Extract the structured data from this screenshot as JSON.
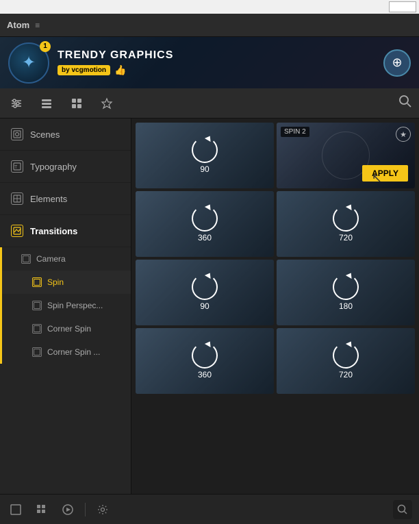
{
  "topBar": {
    "searchPlaceholder": ""
  },
  "menuBar": {
    "title": "Atom",
    "menuIcon": "≡"
  },
  "hero": {
    "badge": "1",
    "title": "TRENDY GRAPHICS",
    "authorLabel": "by vcgmotion",
    "likeIcon": "👍",
    "compassIcon": "⊕"
  },
  "toolbar": {
    "icons": [
      {
        "name": "sliders-icon",
        "symbol": "⊞",
        "active": false
      },
      {
        "name": "list-icon",
        "symbol": "☰",
        "active": false
      },
      {
        "name": "grid-icon",
        "symbol": "⊡",
        "active": false
      },
      {
        "name": "star-icon",
        "symbol": "★",
        "active": false
      }
    ],
    "searchIcon": "🔍"
  },
  "sidebar": {
    "items": [
      {
        "id": "scenes",
        "label": "Scenes",
        "active": false
      },
      {
        "id": "typography",
        "label": "Typography",
        "active": false
      },
      {
        "id": "elements",
        "label": "Elements",
        "active": false
      },
      {
        "id": "transitions",
        "label": "Transitions",
        "active": true
      }
    ],
    "subItems": [
      {
        "id": "camera",
        "label": "Camera",
        "active": false,
        "level": 1
      },
      {
        "id": "spin",
        "label": "Spin",
        "active": true,
        "level": 2
      },
      {
        "id": "spin-perspective",
        "label": "Spin Perspec...",
        "active": false,
        "level": 2
      },
      {
        "id": "corner-spin",
        "label": "Corner Spin",
        "active": false,
        "level": 2
      },
      {
        "id": "corner-spin-2",
        "label": "Corner Spin ...",
        "active": false,
        "level": 2
      }
    ]
  },
  "grid": {
    "items": [
      {
        "id": "item-1",
        "label": "90",
        "featured": false
      },
      {
        "id": "item-2",
        "label": "SPIN 2",
        "featured": true,
        "applyLabel": "APPLY"
      },
      {
        "id": "item-3",
        "label": "360",
        "featured": false
      },
      {
        "id": "item-4",
        "label": "720",
        "featured": false
      },
      {
        "id": "item-5",
        "label": "90",
        "featured": false
      },
      {
        "id": "item-6",
        "label": "180",
        "featured": false
      },
      {
        "id": "item-7",
        "label": "360",
        "featured": false
      },
      {
        "id": "item-8",
        "label": "720",
        "featured": false
      }
    ]
  },
  "bottomBar": {
    "icons": [
      {
        "name": "square-icon",
        "symbol": "□"
      },
      {
        "name": "dots-grid-icon",
        "symbol": "⠿"
      },
      {
        "name": "play-icon",
        "symbol": "▶"
      },
      {
        "name": "settings-icon",
        "symbol": "⚙"
      }
    ],
    "searchIcon": "🔍"
  }
}
